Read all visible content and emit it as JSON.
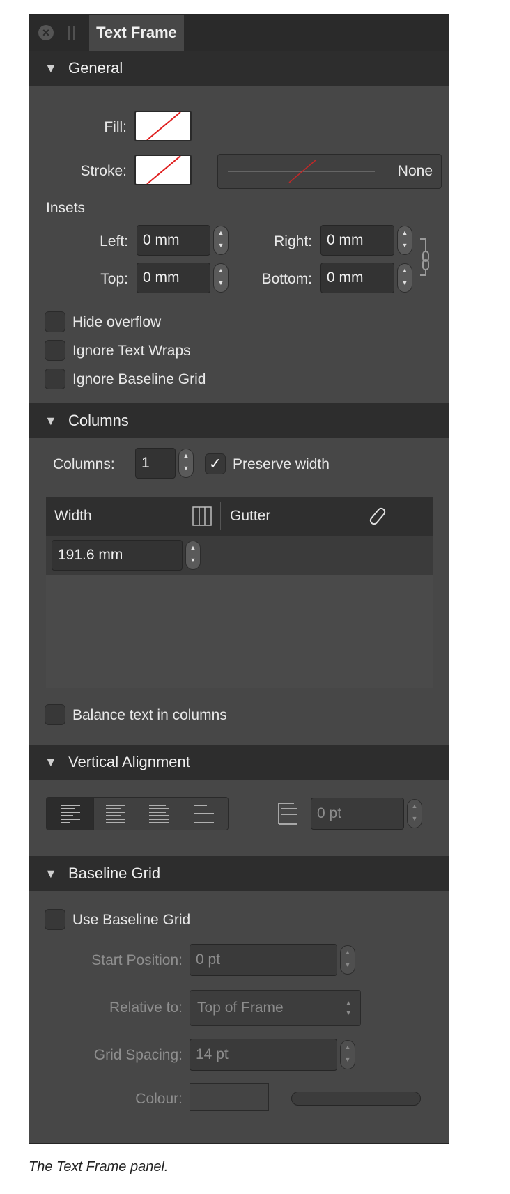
{
  "panel": {
    "tab_title": "Text Frame"
  },
  "general": {
    "header": "General",
    "fill_label": "Fill:",
    "stroke_label": "Stroke:",
    "stroke_style_value": "None",
    "insets_label": "Insets",
    "left_label": "Left:",
    "left_value": "0 mm",
    "right_label": "Right:",
    "right_value": "0 mm",
    "top_label": "Top:",
    "top_value": "0 mm",
    "bottom_label": "Bottom:",
    "bottom_value": "0 mm",
    "hide_overflow": "Hide overflow",
    "ignore_text_wraps": "Ignore Text Wraps",
    "ignore_baseline_grid": "Ignore Baseline Grid"
  },
  "columns": {
    "header": "Columns",
    "columns_label": "Columns:",
    "columns_value": "1",
    "preserve_width": "Preserve width",
    "preserve_width_checked": true,
    "table_headers": [
      "Width",
      "Gutter"
    ],
    "rows": [
      {
        "width": "191.6 mm"
      }
    ],
    "balance_text": "Balance text in columns"
  },
  "vertical_alignment": {
    "header": "Vertical Alignment",
    "offset_value": "0 pt"
  },
  "baseline_grid": {
    "header": "Baseline Grid",
    "use_baseline_grid": "Use Baseline Grid",
    "start_position_label": "Start Position:",
    "start_position_value": "0 pt",
    "relative_to_label": "Relative to:",
    "relative_to_value": "Top of Frame",
    "grid_spacing_label": "Grid Spacing:",
    "grid_spacing_value": "14 pt",
    "colour_label": "Colour:"
  },
  "caption": "The Text Frame panel."
}
